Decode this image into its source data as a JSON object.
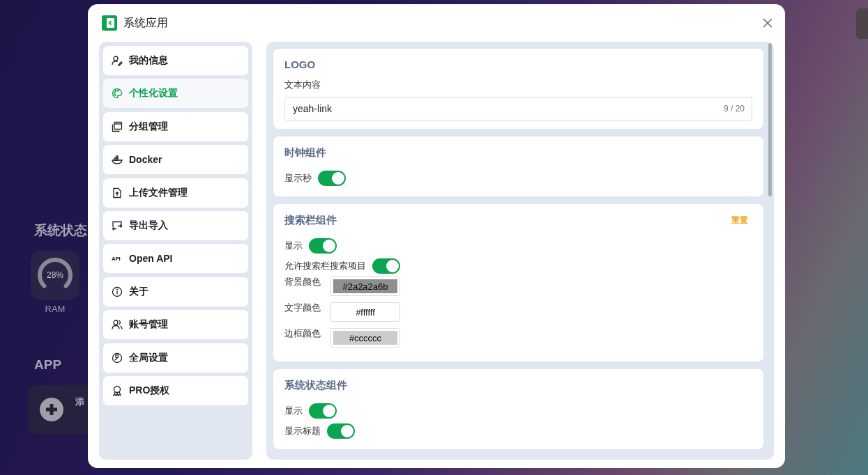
{
  "desktop": {
    "status_title": "系统状态",
    "gauges": [
      {
        "reading": "28%",
        "label": "RAM"
      }
    ],
    "app_title": "APP",
    "add_card": {
      "label": "添"
    }
  },
  "window": {
    "title": "系统应用"
  },
  "sidebar": {
    "items": [
      {
        "label": "我的信息",
        "selected": false
      },
      {
        "label": "个性化设置",
        "selected": true
      },
      {
        "label": "分组管理",
        "selected": false
      },
      {
        "label": "Docker",
        "selected": false
      },
      {
        "label": "上传文件管理",
        "selected": false
      },
      {
        "label": "导出导入",
        "selected": false
      },
      {
        "label": "Open API",
        "selected": false,
        "icon_label": "API"
      },
      {
        "label": "关于",
        "selected": false
      },
      {
        "label": "账号管理",
        "selected": false
      },
      {
        "label": "全局设置",
        "selected": false
      },
      {
        "label": "PRO授权",
        "selected": false
      }
    ]
  },
  "sections": [
    {
      "title": "LOGO",
      "fields": [
        {
          "kind": "text",
          "label": "文本内容",
          "value": "yeah-link",
          "counter": "9 / 20"
        }
      ]
    },
    {
      "title": "时钟组件",
      "fields": [
        {
          "kind": "switch",
          "label": "显示秒",
          "on": true
        }
      ]
    },
    {
      "title": "搜索栏组件",
      "action": "重置",
      "fields": [
        {
          "kind": "switch",
          "label": "显示",
          "on": true
        },
        {
          "kind": "switch",
          "label": "允许搜索栏搜索项目",
          "on": true
        },
        {
          "kind": "color",
          "label": "背景颜色",
          "value": "#2a2a2a6b",
          "color": "#8f8f8f"
        },
        {
          "kind": "color",
          "label": "文字颜色",
          "value": "#ffffff",
          "color": "#ffffff"
        },
        {
          "kind": "color",
          "label": "边框颜色",
          "value": "#cccccc",
          "color": "#cccccc"
        }
      ]
    },
    {
      "title": "系统状态组件",
      "fields": [
        {
          "kind": "switch",
          "label": "显示",
          "on": true
        },
        {
          "kind": "switch",
          "label": "显示标题",
          "on": true
        }
      ]
    }
  ]
}
